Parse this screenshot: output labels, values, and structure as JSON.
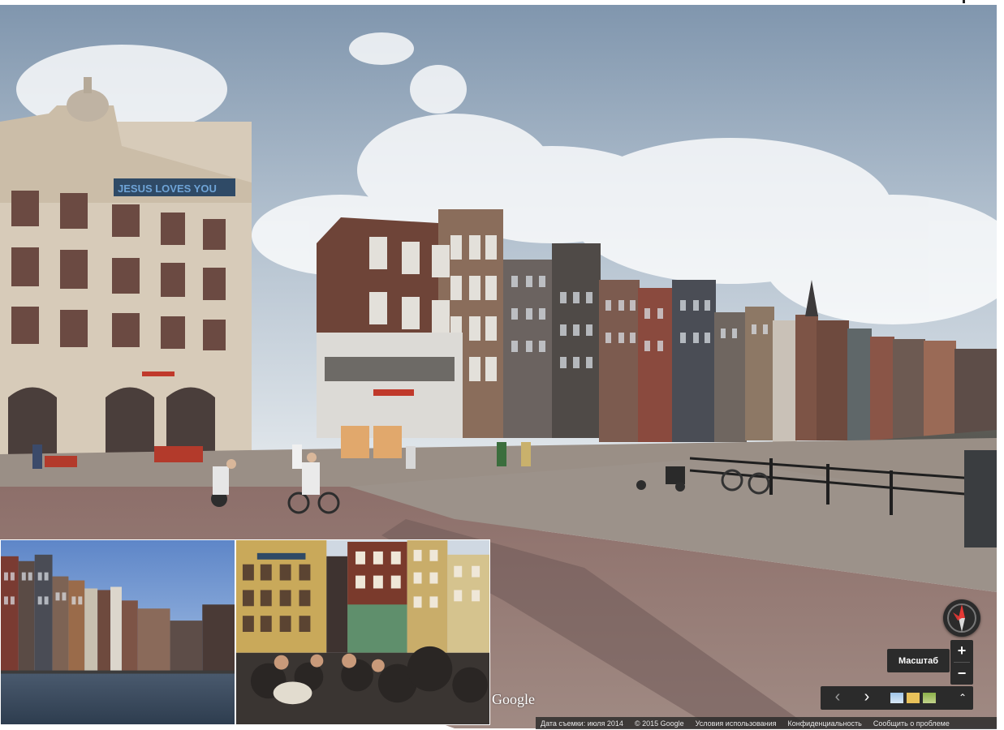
{
  "scene": {
    "sign_text": "JESUS LOVES YOU"
  },
  "branding": {
    "logo_text": "Google"
  },
  "footer": {
    "date": "Дата съемки: июля 2014",
    "copyright": "© 2015 Google",
    "terms": "Условия использования",
    "privacy": "Конфиденциальность",
    "report": "Сообщить о проблеме"
  },
  "controls": {
    "zoom_tooltip": "Масштаб",
    "zoom_in": "+",
    "zoom_out": "−",
    "prev": "‹",
    "next": "›",
    "expand": "⌃"
  },
  "icons": {
    "compass": "compass-icon",
    "prev": "chevron-left-icon",
    "next": "chevron-right-icon",
    "expand": "chevron-up-icon"
  },
  "colors": {
    "control_bg": "#2b2b2b",
    "compass_north": "#e53935"
  }
}
